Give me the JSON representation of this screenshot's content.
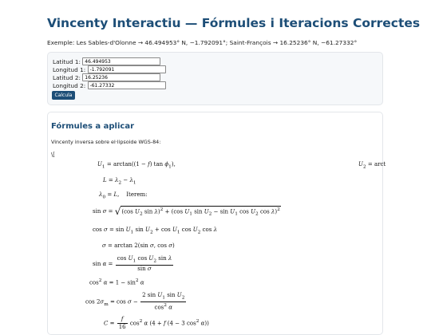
{
  "page": {
    "title": "Vincenty Interactiu — Fórmules i Iteracions Correctes",
    "example": "Exemple: Les Sables-d'Olonne → 46.494953° N, −1.792091°; Saint-François → 16.25236° N, −61.27332°"
  },
  "form": {
    "lat1_label": "Latitud 1:",
    "lat1_value": "46.494953",
    "lon1_label": "Longitud 1:",
    "lon1_value": "-1.792091",
    "lat2_label": "Latitud 2:",
    "lat2_value": "16.25236",
    "lon2_label": "Longitud 2:",
    "lon2_value": "-61.27332",
    "submit_label": "Calcula"
  },
  "formulas": {
    "heading": "Fórmules a aplicar",
    "intro": "Vincenty inversa sobre el·lipsoide WGS-84:",
    "delimiter": "\\[",
    "lines": [
      "U₁ = arctan((1 − f) tan ϕ₁),",
      "U₂ = arct",
      "L = λ₂ − λ₁",
      "λ₀ = L,    Iterem:",
      "sin σ = √((cos U₂ sin λ)² + (cos U₁ sin U₂ − sin U₁ cos U₂ cos λ)²",
      "cos σ = sin U₁ sin U₂ + cos U₁ cos U₂ cos λ",
      "σ = arctan 2(sin σ, cos σ)",
      "sin α = cos U₁ cos U₂ sin λ / sin σ",
      "cos² α = 1 − sin² α",
      "cos 2σₘ = cos σ − 2 sin U₁ sin U₂ / cos² α",
      "C = f/16 cos² α (4 + f (4 − 3 cos² α))"
    ]
  }
}
